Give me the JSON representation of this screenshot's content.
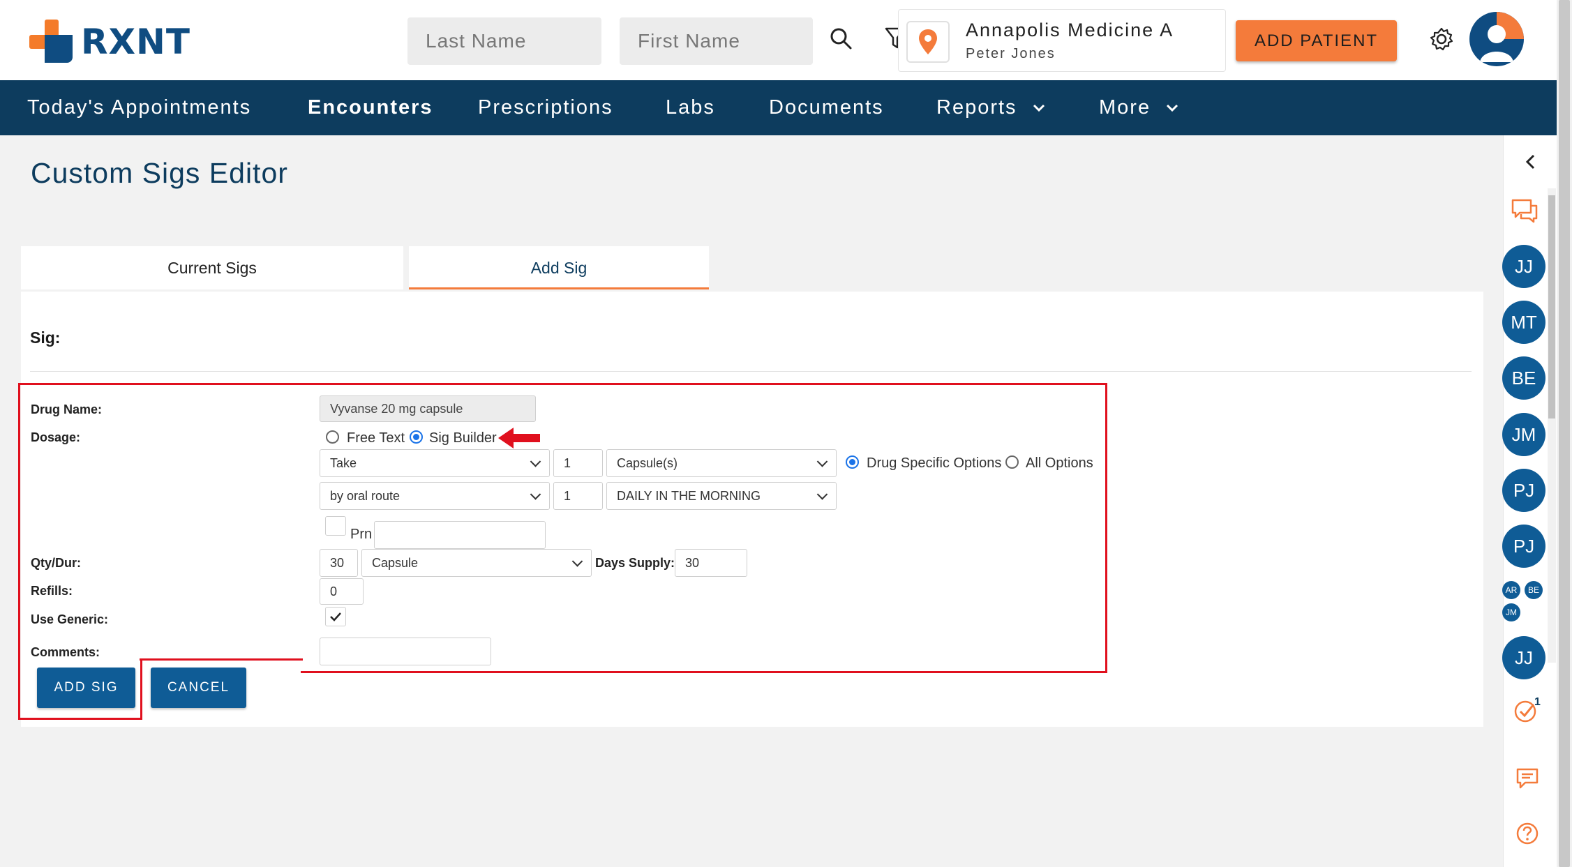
{
  "app": {
    "logo_text": "RXNT",
    "accent_color": "#f47b3b",
    "brand_color": "#0d3c5e"
  },
  "header": {
    "last_name_placeholder": "Last Name",
    "first_name_placeholder": "First Name",
    "search_icon": "search-icon",
    "filter_icon": "filter-icon",
    "location": {
      "name": "Annapolis Medicine A",
      "user": "Peter Jones",
      "icon": "map-pin-icon"
    },
    "add_patient_label": "ADD PATIENT",
    "settings_icon": "gear-icon",
    "avatar_icon": "user-avatar"
  },
  "nav": {
    "items": [
      {
        "label": "Today's Appointments"
      },
      {
        "label": "Encounters",
        "active": true
      },
      {
        "label": "Prescriptions"
      },
      {
        "label": "Labs"
      },
      {
        "label": "Documents"
      },
      {
        "label": "Reports",
        "dropdown": true
      },
      {
        "label": "More",
        "dropdown": true
      }
    ]
  },
  "page": {
    "title": "Custom Sigs Editor",
    "tabs": [
      {
        "label": "Current Sigs"
      },
      {
        "label": "Add Sig",
        "active": true
      }
    ],
    "sig_label": "Sig:"
  },
  "form": {
    "drug_name_label": "Drug Name:",
    "drug_name_value": "Vyvanse 20 mg capsule",
    "dosage_label": "Dosage:",
    "dosage_modes": {
      "free_text": "Free Text",
      "sig_builder": "Sig Builder",
      "selected": "Sig Builder"
    },
    "action_select": "Take",
    "dose_qty": "1",
    "dose_unit_select": "Capsule(s)",
    "option_modes": {
      "drug_specific": "Drug Specific Options",
      "all": "All Options",
      "selected": "Drug Specific Options"
    },
    "route_select": "by oral route",
    "frequency_qty": "1",
    "frequency_select": "DAILY IN THE MORNING",
    "prn_label": "Prn",
    "prn_checked": false,
    "prn_text": "",
    "qty_dur_label": "Qty/Dur:",
    "qty_value": "30",
    "qty_unit_select": "Capsule",
    "days_supply_label": "Days Supply:",
    "days_supply_value": "30",
    "refills_label": "Refills:",
    "refills_value": "0",
    "use_generic_label": "Use Generic:",
    "use_generic_checked": true,
    "comments_label": "Comments:",
    "comments_value": "",
    "add_sig_label": "ADD SIG",
    "cancel_label": "CANCEL"
  },
  "sidebar": {
    "collapse_icon": "chevron-left-icon",
    "chat_icon": "chat-bubbles-icon",
    "users": [
      "JJ",
      "MT",
      "BE",
      "JM",
      "PJ",
      "PJ"
    ],
    "mini_users": [
      "AR",
      "BE",
      "JM"
    ],
    "last_user": "JJ",
    "tasks_icon": "check-circle-icon",
    "tasks_badge": "1",
    "message_icon": "message-icon",
    "help_icon": "help-icon"
  }
}
